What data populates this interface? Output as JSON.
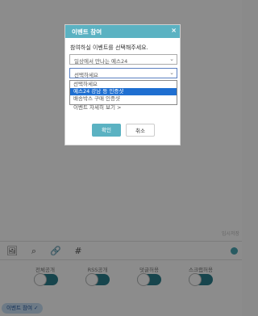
{
  "page": {
    "temp_saved": "임시저장",
    "options": [
      {
        "label": "전체공개"
      },
      {
        "label": "RSS공개"
      },
      {
        "label": "덧글허용"
      },
      {
        "label": "스크랩허용"
      }
    ],
    "event_chip": "이벤트 참여 ✓"
  },
  "modal": {
    "title": "이벤트 참여",
    "close": "×",
    "prompt": "참여하실 이벤트를 선택해주세요.",
    "event_select": "일상에서 만나는 예스24",
    "detail_select": "선택하세요",
    "options": [
      {
        "label": "선택하세요"
      },
      {
        "label": "예스24 강남 등 인증샷"
      },
      {
        "label": "배송박스 구매 인증샷"
      }
    ],
    "detail_link": "이벤트 자세히 보기 >",
    "ok": "확인",
    "cancel": "취소"
  }
}
